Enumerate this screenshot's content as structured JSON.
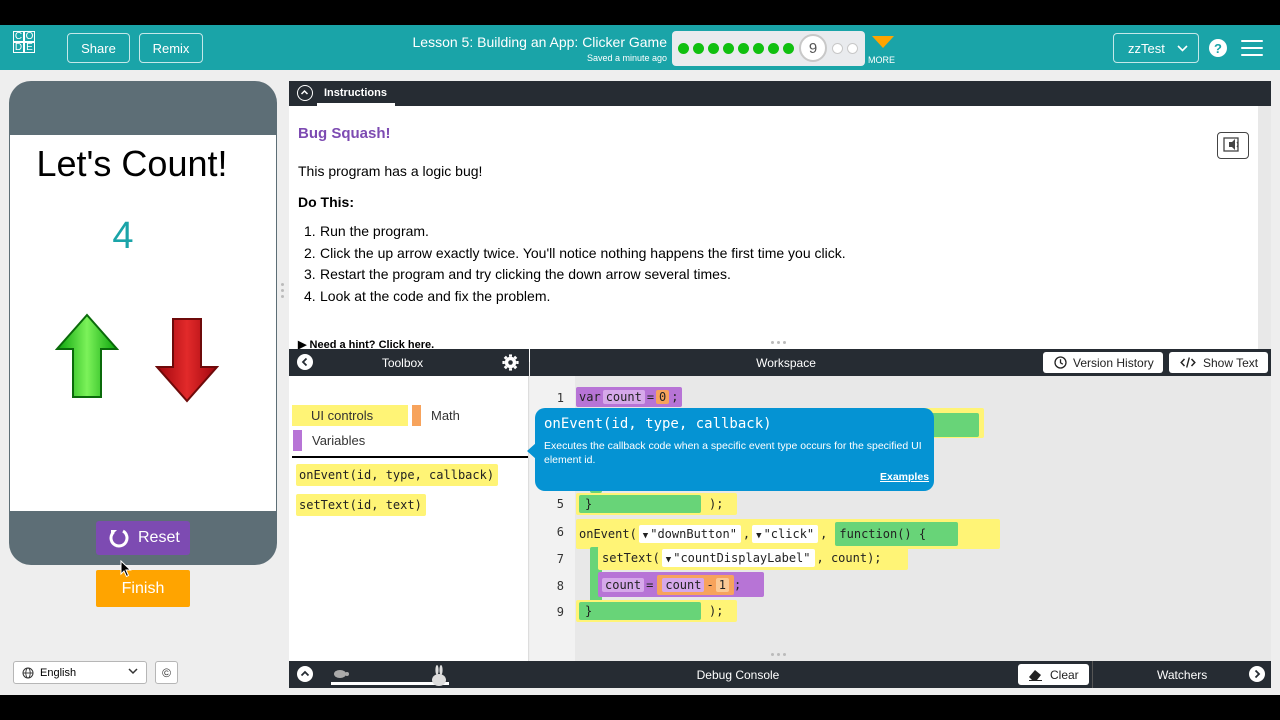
{
  "header": {
    "logo_letters": [
      "C",
      "O",
      "D",
      "E"
    ],
    "share_label": "Share",
    "remix_label": "Remix",
    "lesson_title": "Lesson 5: Building an App: Clicker Game",
    "saved_text": "Saved a minute ago",
    "progress": {
      "completed_levels": 8,
      "current_level": "9",
      "remaining_levels": 2
    },
    "more_label": "MORE",
    "user_name": "zzTest",
    "help_symbol": "?"
  },
  "app": {
    "title": "Let's Count!",
    "count": "4",
    "reset_label": "Reset",
    "finish_label": "Finish"
  },
  "footer": {
    "language": "English",
    "copyright_symbol": "©"
  },
  "instructions": {
    "tab_label": "Instructions",
    "title": "Bug Squash!",
    "intro": "This program has a logic bug!",
    "do_this": "Do This:",
    "steps": [
      {
        "num": "1.",
        "text": "Run the program."
      },
      {
        "num": "2.",
        "text": "Click the up arrow exactly twice. You'll notice nothing happens the first time you click."
      },
      {
        "num": "3.",
        "text": "Restart the program and try clicking the down arrow several times."
      },
      {
        "num": "4.",
        "text": "Look at the code and fix the problem."
      }
    ],
    "hint": "▶ Need a hint? Click here."
  },
  "toolbox": {
    "title": "Toolbox",
    "categories": [
      {
        "label": "UI controls",
        "color": "#fff476"
      },
      {
        "label": "Math",
        "color": "#f7a35c"
      },
      {
        "label": "Variables",
        "color": "#b774d6"
      }
    ],
    "blocks": [
      {
        "name": "onEvent",
        "params": "(id, type, callback)"
      },
      {
        "name": "setText",
        "params": "(id, text)"
      }
    ]
  },
  "workspace": {
    "title": "Workspace",
    "version_history_label": "Version History",
    "show_text_label": "Show Text",
    "line_numbers": [
      "1",
      "5",
      "6",
      "7",
      "8",
      "9"
    ],
    "code": {
      "line1": {
        "kw": "var",
        "var": "count",
        "eq": "=",
        "val": "0",
        "end": ";"
      },
      "line5": {
        "close": "}",
        "end": ");"
      },
      "line6": {
        "fn": "onEvent(",
        "tri": "▼",
        "id": "\"downButton\"",
        "comma1": ",",
        "evt": "\"click\"",
        "comma2": ",",
        "func": "function() {"
      },
      "line7": {
        "fn": "setText(",
        "tri": "▼",
        "id": "\"countDisplayLabel\"",
        "arg": ", count);"
      },
      "line8": {
        "var": "count",
        "eq": "=",
        "lhs": "count",
        "op": "-",
        "rhs": "1",
        "end": ";"
      },
      "line9": {
        "close": "}",
        "end": ");"
      }
    }
  },
  "tooltip": {
    "signature": "onEvent(id, type, callback)",
    "description": "Executes the callback code when a specific event type occurs for the specified UI element id.",
    "examples_label": "Examples"
  },
  "debug": {
    "title": "Debug Console",
    "clear_label": "Clear",
    "watchers_label": "Watchers"
  },
  "colors": {
    "header_teal": "#1aa4a8",
    "purple": "#7d4bb2",
    "orange": "#ffa400",
    "dark_bar": "#262c33",
    "tooltip_blue": "#0593d3",
    "block_yellow": "#fff476",
    "block_green": "#68d478",
    "block_purple": "#b774d6",
    "block_orange": "#f7a35c"
  }
}
